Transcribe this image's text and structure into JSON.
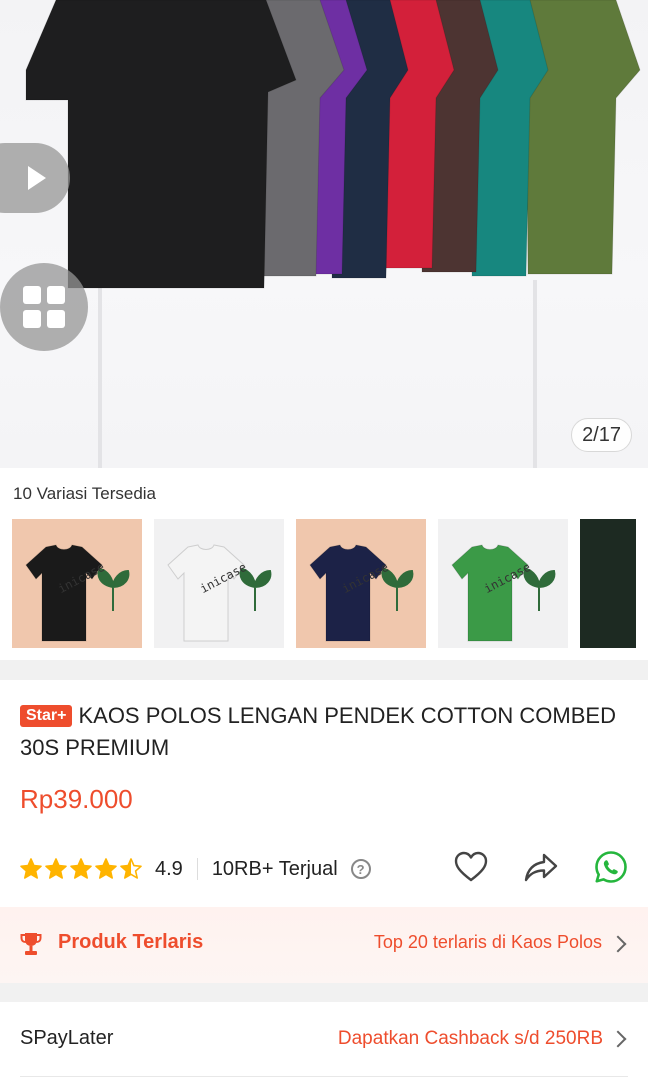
{
  "gallery": {
    "counter": "2/17",
    "shirt_colors": [
      "#1e1e1f",
      "#6b6a6e",
      "#6e2fa3",
      "#1f2d44",
      "#d3203a",
      "#4d3432",
      "#17877f",
      "#5f7a3b"
    ]
  },
  "variants": {
    "label": "10 Variasi Tersedia",
    "thumbnails": [
      {
        "shirt_color": "#1a1a1a",
        "bg": "peach",
        "watermark": "inicase"
      },
      {
        "shirt_color": "#f4f4f4",
        "bg": "white",
        "watermark": "inicase"
      },
      {
        "shirt_color": "#1c2247",
        "bg": "peach",
        "watermark": "inicase"
      },
      {
        "shirt_color": "#3b9a47",
        "bg": "white",
        "watermark": "inicase"
      }
    ]
  },
  "product": {
    "badge": "Star+",
    "title": "KAOS POLOS LENGAN PENDEK COTTON COMBED 30S PREMIUM",
    "price": "Rp39.000",
    "rating": "4.9",
    "rating_value": 4.5,
    "sold": "10RB+ Terjual"
  },
  "bestseller": {
    "label": "Produk Terlaris",
    "link": "Top 20 terlaris di Kaos Polos"
  },
  "paylater": {
    "label": "SPayLater",
    "value": "Dapatkan Cashback s/d 250RB"
  },
  "colors": {
    "accent": "#ee4d2d",
    "star": "#ffb400",
    "whatsapp": "#25b63d"
  },
  "icons": [
    "play-icon",
    "grid-icon",
    "star-icon",
    "help-icon",
    "heart-icon",
    "share-icon",
    "whatsapp-icon",
    "trophy-icon",
    "chevron-right-icon"
  ]
}
